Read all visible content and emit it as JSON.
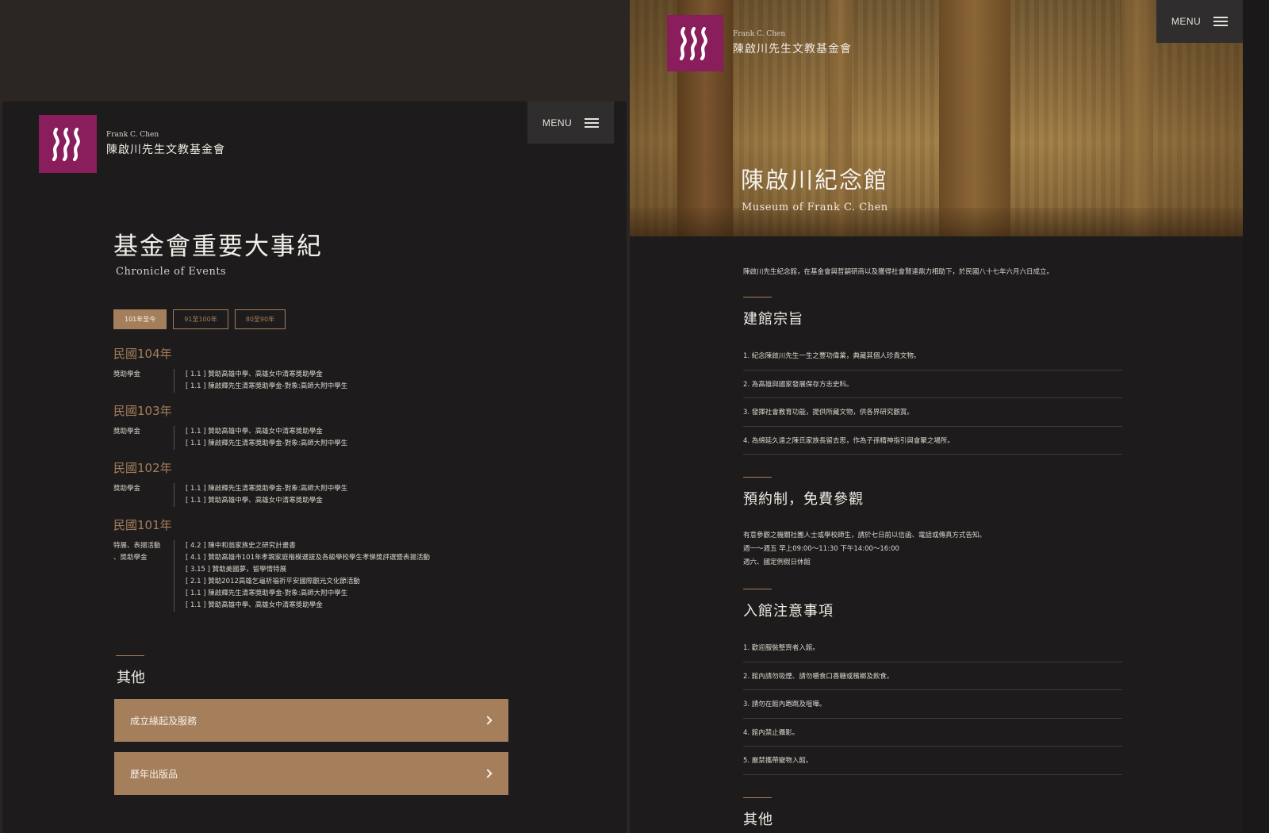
{
  "left": {
    "logo": {
      "en": "Frank C. Chen",
      "zh": "陳啟川先生文教基金會"
    },
    "menu_label": "MENU",
    "title": "基金會重要大事紀",
    "subtitle": "Chronicle of Events",
    "tabs": [
      {
        "label": "101年至今",
        "active": true
      },
      {
        "label": "91至100年",
        "active": false
      },
      {
        "label": "80至90年",
        "active": false
      }
    ],
    "years": [
      {
        "year": "民國104年",
        "category": "獎助學金",
        "items": [
          "[ 1.1 ]  贊助高雄中學、高雄女中清寒獎助學金",
          "[ 1.1 ]  陳啟輝先生清寒獎助學金-對象:高師大附中學生"
        ]
      },
      {
        "year": "民國103年",
        "category": "獎助學金",
        "items": [
          "[ 1.1 ]  贊助高雄中學、高雄女中清寒獎助學金",
          "[ 1.1 ]  陳啟輝先生清寒獎助學金-對象:高師大附中學生"
        ]
      },
      {
        "year": "民國102年",
        "category": "獎助學金",
        "items": [
          "[ 1.1 ]  陳啟輝先生清寒獎助學金-對象:高師大附中學生",
          "[ 1.1 ]  贊助高雄中學、高雄女中清寒獎助學金"
        ]
      },
      {
        "year": "民國101年",
        "category": "特展、表揚活動\n、獎助學金",
        "items": [
          "[ 4.2 ]  陳中和翁家族史之研究計畫書",
          "[ 4.1 ]  贊助高雄市101年孝親家庭楷模選拔及各級學校學生孝悌獎評選暨表揚活動",
          "[ 3.15 ] 贊助美國夢，留學情特展",
          "[ 2.1 ]  贊助2012高雄乞龜祈福祈平安國際觀光文化節活動",
          "[ 1.1 ]  陳啟輝先生清寒獎助學金-對象:高師大附中學生",
          "[ 1.1 ]  贊助高雄中學、高雄女中清寒獎助學金"
        ]
      }
    ],
    "other_title": "其他",
    "links": [
      "成立緣起及服務",
      "歷年出版品"
    ]
  },
  "right": {
    "logo": {
      "en": "Frank C. Chen",
      "zh": "陳啟川先生文教基金會"
    },
    "menu_label": "MENU",
    "hero_title": "陳啟川紀念館",
    "hero_subtitle": "Museum of Frank C. Chen",
    "intro": "陳啟川先生紀念館，在基金會與哲嗣研商以及獲得社會賢達鼎力相助下，於民國八十七年六月六日成立。",
    "purpose": {
      "title": "建館宗旨",
      "items": [
        "1.  紀念陳啟川先生一生之豐功偉業，典藏其個人珍貴文物。",
        "2.  為高雄與國家發展保存方志史料。",
        "3.  發揮社會教育功能，提供所藏文物，供各界研究觀賞。",
        "4.  為綿延久遠之陳氏家族長留去思，作為子孫精神指引與會聚之場所。"
      ]
    },
    "visit": {
      "title": "預約制，免費參觀",
      "lines": [
        "有意參觀之機關社團人士或學校師生，請於七日前以信函、電話或傳真方式告知。",
        "週一～週五  早上09:00～11:30  下午14:00～16:00",
        "週六、國定例假日休館"
      ]
    },
    "rules": {
      "title": "入館注意事項",
      "items": [
        "1.  歡迎服裝整齊者入館。",
        "2.  館內請勿吸煙、請勿嚼食口香糖或檳榔及飲食。",
        "3.  請勿在館內跑跳及喧嘩。",
        "4.  館內禁止攝影。",
        "5.  嚴禁攜帶寵物入館。"
      ]
    },
    "other_title": "其他"
  },
  "colors": {
    "accent": "#a57f5c",
    "logo": "#8a1e5c",
    "bg": "#1d1b1b"
  }
}
